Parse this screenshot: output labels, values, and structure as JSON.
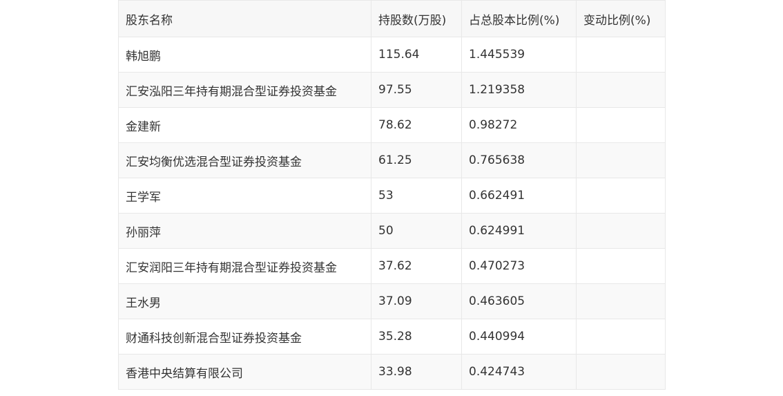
{
  "table": {
    "headers": [
      "股东名称",
      "持股数(万股)",
      "占总股本比例(%)",
      "变动比例(%)"
    ],
    "rows": [
      [
        "韩旭鹏",
        "115.64",
        "1.445539",
        ""
      ],
      [
        "汇安泓阳三年持有期混合型证券投资基金",
        "97.55",
        "1.219358",
        ""
      ],
      [
        "金建新",
        "78.62",
        "0.98272",
        ""
      ],
      [
        "汇安均衡优选混合型证券投资基金",
        "61.25",
        "0.765638",
        ""
      ],
      [
        "王学军",
        "53",
        "0.662491",
        ""
      ],
      [
        "孙丽萍",
        "50",
        "0.624991",
        ""
      ],
      [
        "汇安润阳三年持有期混合型证券投资基金",
        "37.62",
        "0.470273",
        ""
      ],
      [
        "王水男",
        "37.09",
        "0.463605",
        ""
      ],
      [
        "财通科技创新混合型证券投资基金",
        "35.28",
        "0.440994",
        ""
      ],
      [
        "香港中央结算有限公司",
        "33.98",
        "0.424743",
        ""
      ]
    ]
  }
}
